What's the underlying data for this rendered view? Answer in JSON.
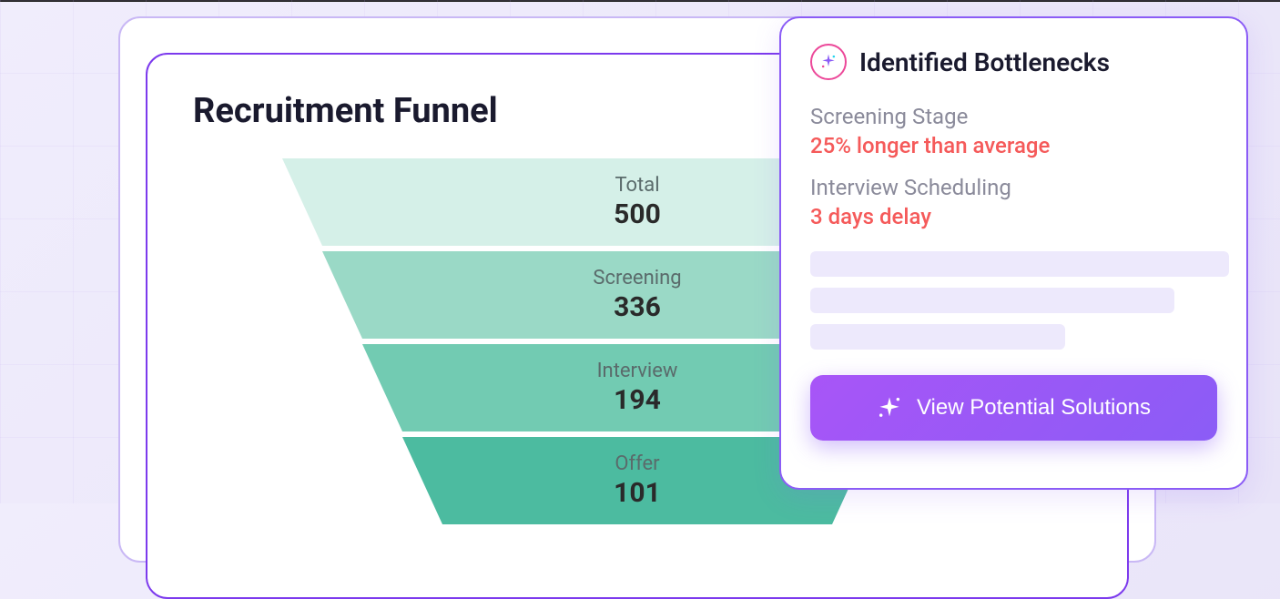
{
  "main": {
    "title": "Recruitment Funnel"
  },
  "chart_data": {
    "type": "funnel",
    "title": "Recruitment Funnel",
    "stages": [
      {
        "label": "Total",
        "value": 500,
        "color": "#d5f0e8"
      },
      {
        "label": "Screening",
        "value": 336,
        "color": "#9ad9c6"
      },
      {
        "label": "Interview",
        "value": 194,
        "color": "#72cbb2"
      },
      {
        "label": "Offer",
        "value": 101,
        "color": "#4cbba0"
      }
    ]
  },
  "panel": {
    "title": "Identified Bottlenecks",
    "items": [
      {
        "label": "Screening Stage",
        "value": "25% longer than average"
      },
      {
        "label": "Interview Scheduling",
        "value": "3 days delay"
      }
    ],
    "placeholder_widths": [
      460,
      400,
      280
    ],
    "cta": "View Potential Solutions"
  }
}
